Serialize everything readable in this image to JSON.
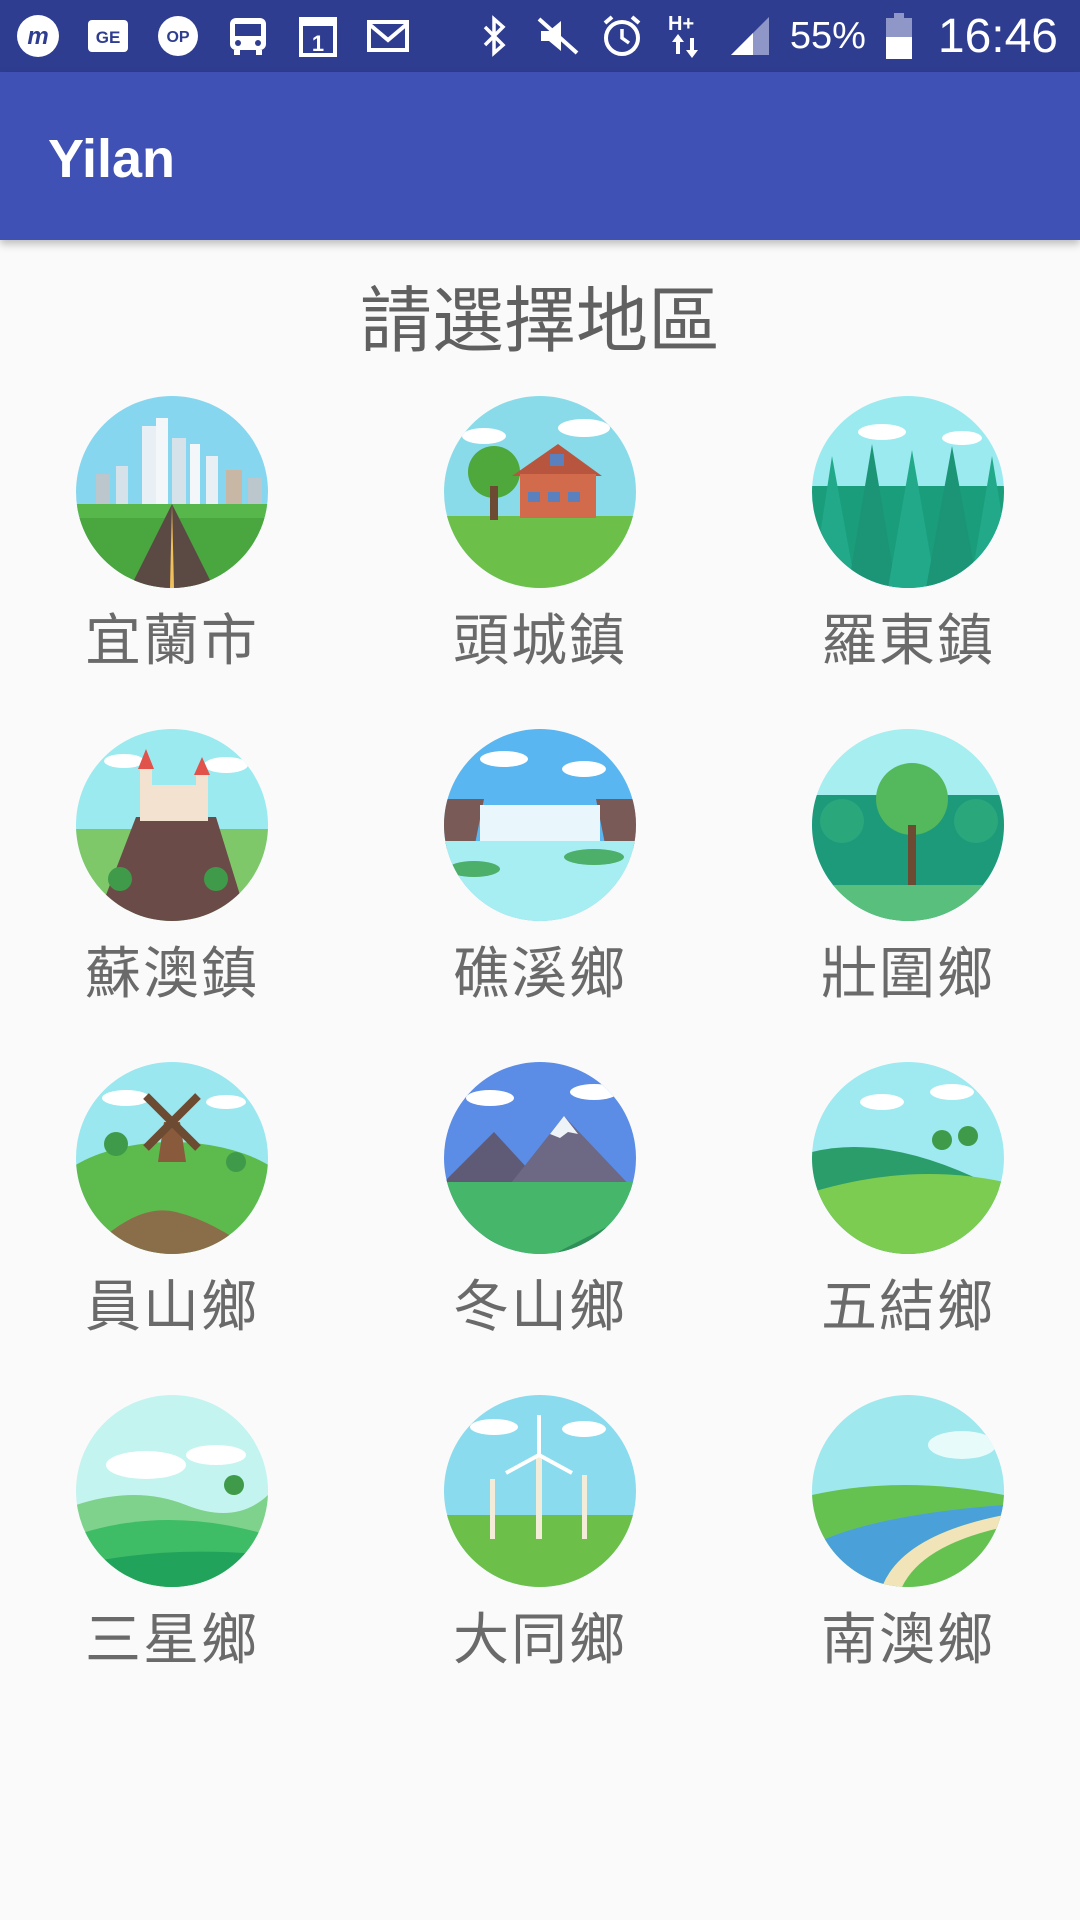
{
  "status_bar": {
    "left_icons": [
      "moovit-icon",
      "ge-icon",
      "op-icon",
      "bus-icon",
      "calendar-icon",
      "gmail-icon"
    ],
    "right_icons": [
      "bluetooth-icon",
      "mute-icon",
      "alarm-icon",
      "hplus-data-icon",
      "signal-icon"
    ],
    "battery_percent": "55%",
    "time": "16:46",
    "colors": {
      "bar": "#2f3d91"
    }
  },
  "app_bar": {
    "title": "Yilan",
    "color": "#3f51b5"
  },
  "heading": "請選擇地區",
  "regions": [
    {
      "label": "宜蘭市",
      "scene": "city"
    },
    {
      "label": "頭城鎮",
      "scene": "house"
    },
    {
      "label": "羅東鎮",
      "scene": "forest"
    },
    {
      "label": "蘇澳鎮",
      "scene": "castle"
    },
    {
      "label": "礁溪鄉",
      "scene": "waterfall"
    },
    {
      "label": "壯圍鄉",
      "scene": "trees"
    },
    {
      "label": "員山鄉",
      "scene": "windmill"
    },
    {
      "label": "冬山鄉",
      "scene": "mountain"
    },
    {
      "label": "五結鄉",
      "scene": "meadow"
    },
    {
      "label": "三星鄉",
      "scene": "hills"
    },
    {
      "label": "大同鄉",
      "scene": "wind-turbines"
    },
    {
      "label": "南澳鄉",
      "scene": "river"
    }
  ]
}
